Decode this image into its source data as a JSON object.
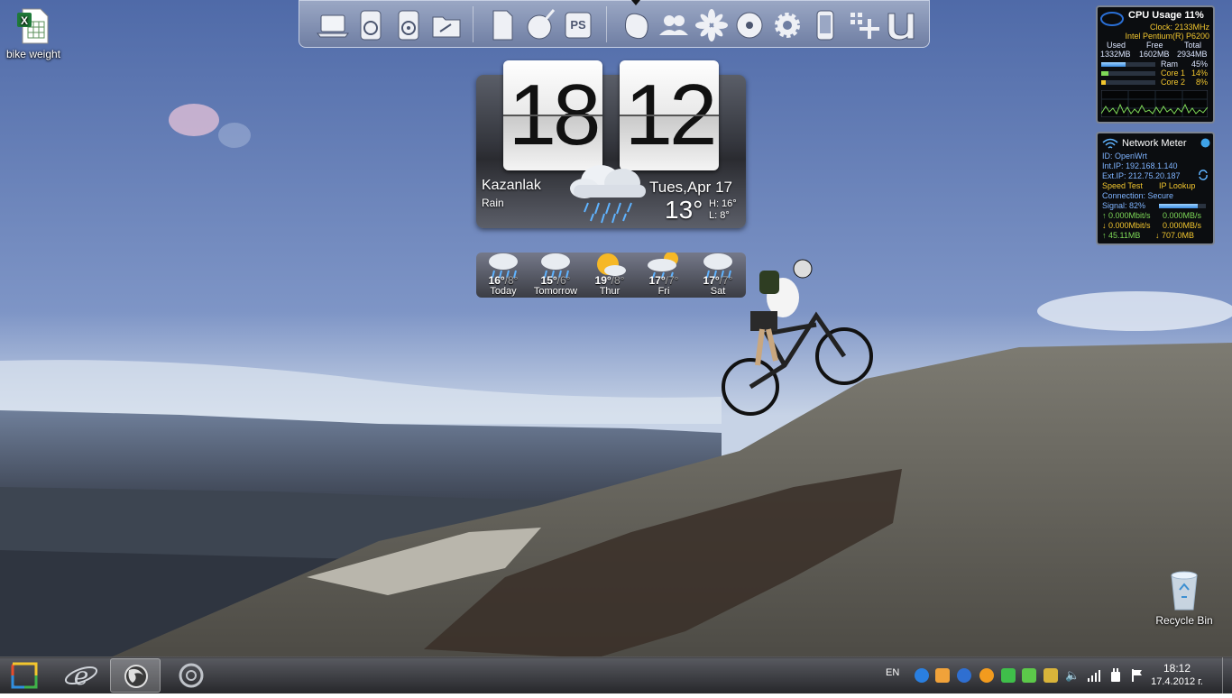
{
  "desktop": {
    "file_icon_label": "bike weight",
    "recycle_bin_label": "Recycle Bin"
  },
  "dock": {
    "icons": [
      "laptop-icon",
      "music-icon",
      "music-alt-icon",
      "folder-tools-icon",
      "document-icon",
      "paint-icon",
      "photoshop-icon",
      "blob-icon",
      "users-icon",
      "flower-icon",
      "disc-icon",
      "gear-icon",
      "phone-icon",
      "grid-add-icon",
      "utorrent-icon"
    ],
    "photoshop_text": "PS"
  },
  "clock_widget": {
    "hours": "18",
    "minutes": "12",
    "city": "Kazanlak",
    "condition": "Rain",
    "date": "Tues,Apr 17",
    "temperature": "13°",
    "high": "H:  16°",
    "low": "L:    8°"
  },
  "forecast": [
    {
      "high": "16°",
      "low": "/8°",
      "day": "Today",
      "icon": "rain-icon"
    },
    {
      "high": "15°",
      "low": "/6°",
      "day": "Tomorrow",
      "icon": "rain-icon"
    },
    {
      "high": "19°",
      "low": "/8°",
      "day": "Thur",
      "icon": "sun-cloud-icon"
    },
    {
      "high": "17°",
      "low": "/7°",
      "day": "Fri",
      "icon": "partly-sunny-rain-icon"
    },
    {
      "high": "17°",
      "low": "/7°",
      "day": "Sat",
      "icon": "rain-icon"
    }
  ],
  "cpu_gadget": {
    "title": "CPU Usage",
    "usage": "11%",
    "clock": "Clock: 2133MHz",
    "processor": "Intel Pentium(R) P6200",
    "used_label": "Used",
    "free_label": "Free",
    "total_label": "Total",
    "used": "1332MB",
    "free": "1602MB",
    "total": "2934MB",
    "ram_label": "Ram",
    "ram_value": "45%",
    "ram_fraction": 0.45,
    "core1_label": "Core 1",
    "core1_value": "14%",
    "core1_fraction": 0.14,
    "core2_label": "Core 2",
    "core2_value": "8%",
    "core2_fraction": 0.08
  },
  "network_gadget": {
    "title": "Network Meter",
    "id": "ID: OpenWrt",
    "int_ip": "Int.IP: 192.168.1.140",
    "ext_ip": "Ext.IP: 212.75.20.187",
    "speed_test": "Speed Test",
    "ip_lookup": "IP Lookup",
    "connection": "Connection: Secure",
    "signal": "Signal: 82%",
    "signal_fraction": 0.82,
    "up_rate": "0.000Mbit/s",
    "up_mb": "0.000MB/s",
    "down_rate": "0.000Mbit/s",
    "down_mb": "0.000MB/s",
    "total_up": "45.11MB",
    "total_down": "707.0MB"
  },
  "taskbar": {
    "language": "EN",
    "time": "18:12",
    "date": "17.4.2012 г."
  },
  "colors": {
    "sky_top": "#5d79b6",
    "gadget_yellow": "#f2c62e",
    "gadget_blue": "#7fb4ff"
  }
}
